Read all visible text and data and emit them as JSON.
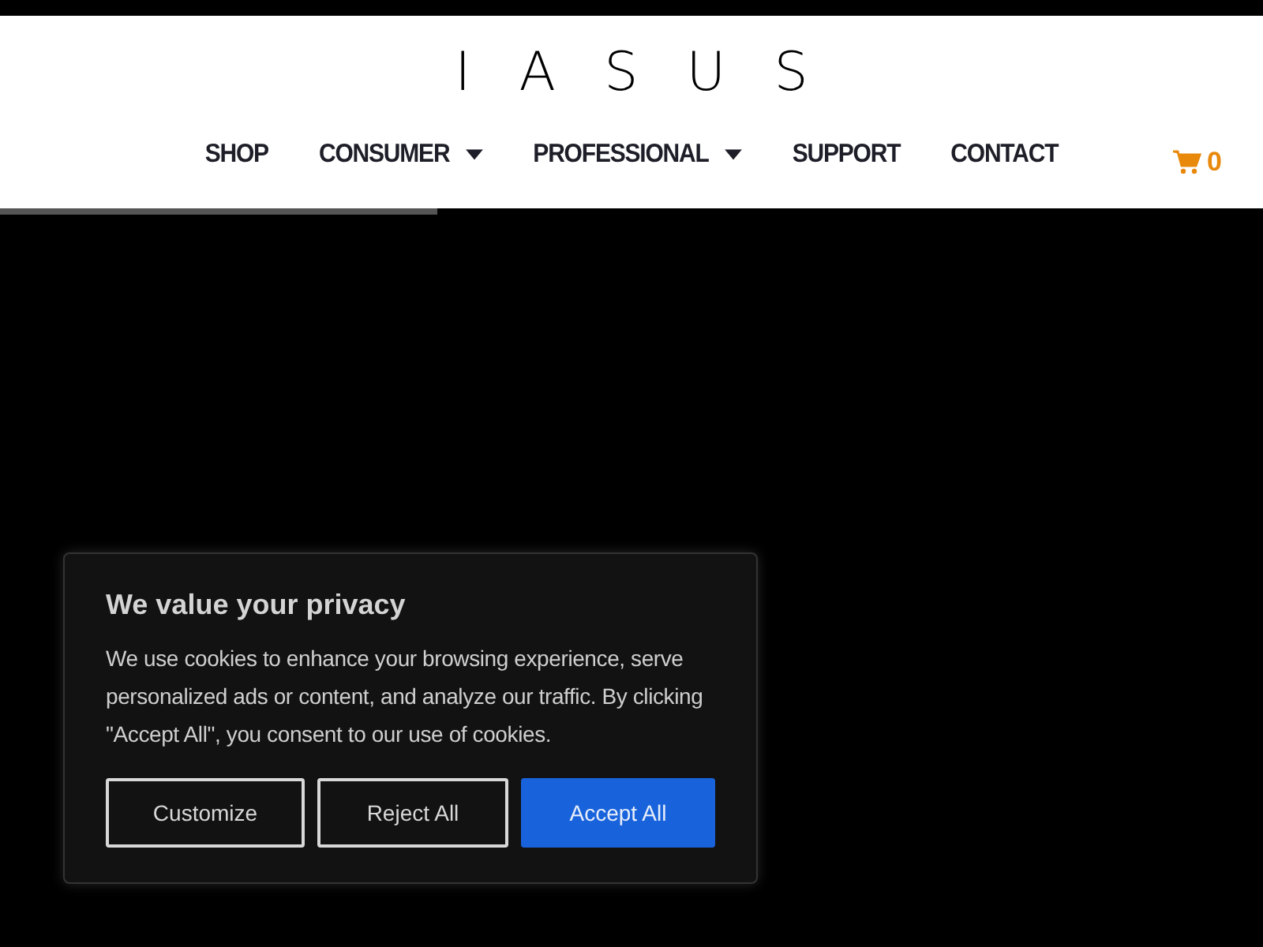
{
  "logo": "IASUS",
  "nav": [
    {
      "label": "SHOP",
      "has_menu": false
    },
    {
      "label": "CONSUMER",
      "has_menu": true
    },
    {
      "label": "PROFESSIONAL",
      "has_menu": true
    },
    {
      "label": "SUPPORT",
      "has_menu": false
    },
    {
      "label": "CONTACT",
      "has_menu": false
    }
  ],
  "cart": {
    "count": "0"
  },
  "progress": {
    "level": 0.346
  },
  "cookie_banner": {
    "title": "We value your privacy",
    "text": "We use cookies to enhance your browsing experience, serve personalized ads or content, and analyze our traffic. By clicking \"Accept All\", you consent to our use of cookies.",
    "buttons": [
      {
        "label": "Customize",
        "kind": "outline"
      },
      {
        "label": "Reject All",
        "kind": "outline"
      },
      {
        "label": "Accept All",
        "kind": "primary"
      }
    ]
  }
}
